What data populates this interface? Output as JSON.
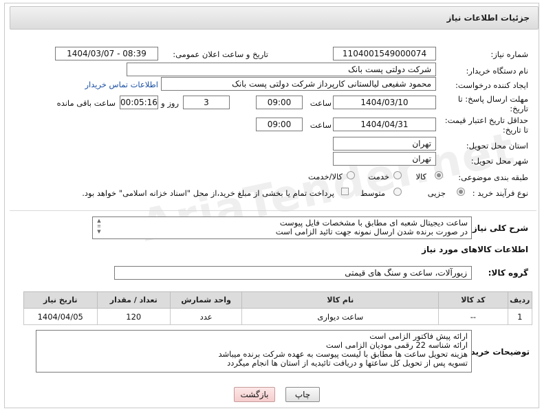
{
  "window": {
    "title": "جزئیات اطلاعات نیاز"
  },
  "form": {
    "need_number_label": "شماره نیاز:",
    "need_number": "1104001549000074",
    "announce_label": "تاریخ و ساعت اعلان عمومی:",
    "announce_value": "1404/03/07 - 08:39",
    "buyer_org_label": "نام دستگاه خریدار:",
    "buyer_org": "شرکت دولتی پست بانک",
    "creator_label": "ایجاد کننده درخواست:",
    "creator": "محمود شفیعی لیالستانی کارپرداز شرکت دولتی پست بانک",
    "contact_link": "اطلاعات تماس خریدار",
    "deadline_label_1": "مهلت ارسال پاسخ: تا",
    "deadline_label_2": "تاریخ:",
    "deadline_date": "1404/03/10",
    "time_label": "ساعت",
    "deadline_time": "09:00",
    "days_value": "3",
    "days_label": "روز و",
    "remaining_value": "00:05:16",
    "remaining_label": "ساعت باقی مانده",
    "validity_label_1": "حداقل تاریخ اعتبار قیمت:",
    "validity_label_2": "تا تاریخ:",
    "validity_date": "1404/04/31",
    "validity_time": "09:00",
    "province_label": "استان محل تحویل:",
    "province": "تهران",
    "city_label": "شهر محل تحویل:",
    "city": "تهران",
    "category_label": "طبقه بندی موضوعی:",
    "category_options": [
      "کالا",
      "خدمت",
      "کالا/خدمت"
    ],
    "category_selected": "کالا",
    "process_label": "نوع فرآیند خرید :",
    "process_options": [
      "جزیی",
      "متوسط"
    ],
    "process_selected": "جزیی",
    "payment_note": "پرداخت تمام یا بخشی از مبلغ خرید،از محل \"اسناد خزانه اسلامی\" خواهد بود.",
    "summary_label": "شرح کلی نیاز:",
    "summary_lines": [
      "ساعت دیجیتال شعبه ای مطابق با مشخصات فایل پیوست",
      "در صورت برنده شدن ارسال نمونه جهت تائید الزامی است"
    ],
    "goods_info_heading": "اطلاعات کالاهای مورد نیاز",
    "goods_group_label": "گروه کالا:",
    "goods_group": "زیورآلات، ساعت و سنگ های قیمتی"
  },
  "table": {
    "headers": [
      "ردیف",
      "کد کالا",
      "نام کالا",
      "واحد شمارش",
      "تعداد / مقدار",
      "تاریخ نیاز"
    ],
    "rows": [
      [
        "1",
        "--",
        "ساعت دیواری",
        "عدد",
        "120",
        "1404/04/05"
      ]
    ]
  },
  "buyer_notes": {
    "label": "توضیحات خریدار:",
    "lines": [
      "ارائه پیش فاکتور الزامی است",
      "ارائه شناسه 22 رقمی مودیان الزامی است",
      "هزینه تحویل ساعت ها مطابق با لیست پیوست به عهده شرکت برنده میباشد",
      "تسویه پس از تحویل  کل ساعتها و دریافت تائیدیه از استان ها انجام میگردد"
    ]
  },
  "buttons": {
    "print": "چاپ",
    "back": "بازگشت"
  },
  "colors": {
    "link": "#1a4fa3",
    "title_bar": "#e4e4e4",
    "back_button": "#f7d4d4"
  }
}
